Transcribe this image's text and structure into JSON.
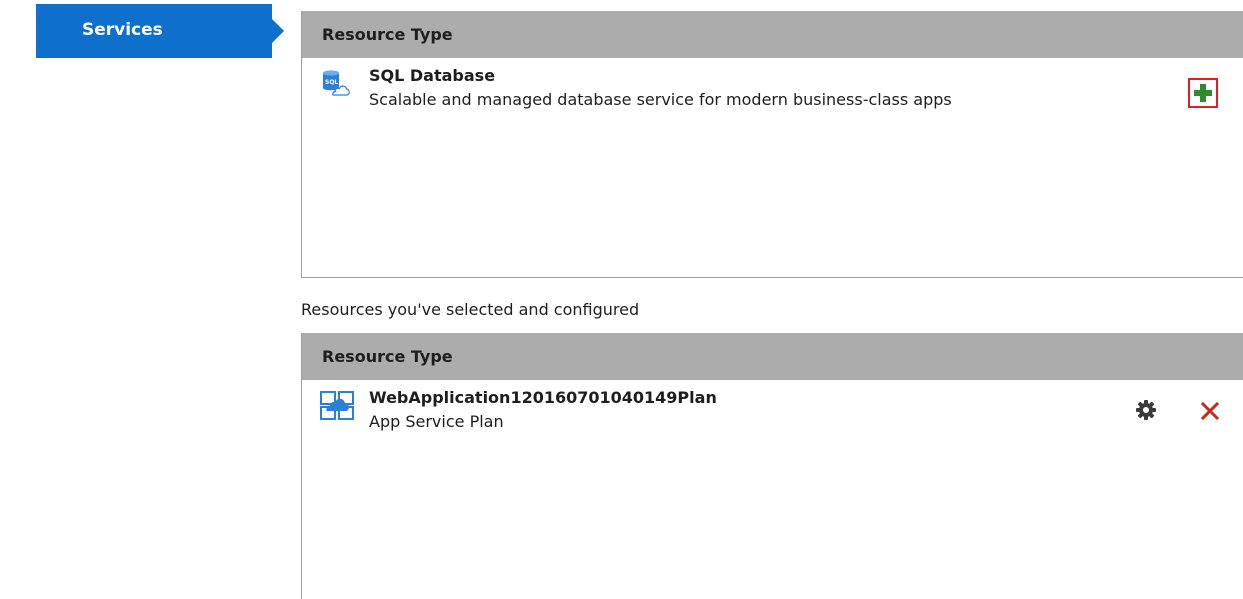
{
  "nav": {
    "active_tab": "Services"
  },
  "available": {
    "header": "Resource Type",
    "items": [
      {
        "title": "SQL Database",
        "description": "Scalable and managed database service for modern business-class apps",
        "icon": "sql-database-icon",
        "action_icon": "add-icon"
      }
    ]
  },
  "configured": {
    "caption": "Resources you've selected and configured",
    "header": "Resource Type",
    "items": [
      {
        "title": "WebApplication120160701040149Plan",
        "description": "App Service Plan",
        "icon": "app-service-plan-icon",
        "actions": [
          "gear-icon",
          "delete-icon"
        ]
      }
    ]
  },
  "colors": {
    "nav_blue": "#0e6fcd",
    "header_gray": "#acacac",
    "add_green": "#2e8b2e",
    "highlight_red": "#e01e24",
    "delete_red": "#c42b1c"
  }
}
